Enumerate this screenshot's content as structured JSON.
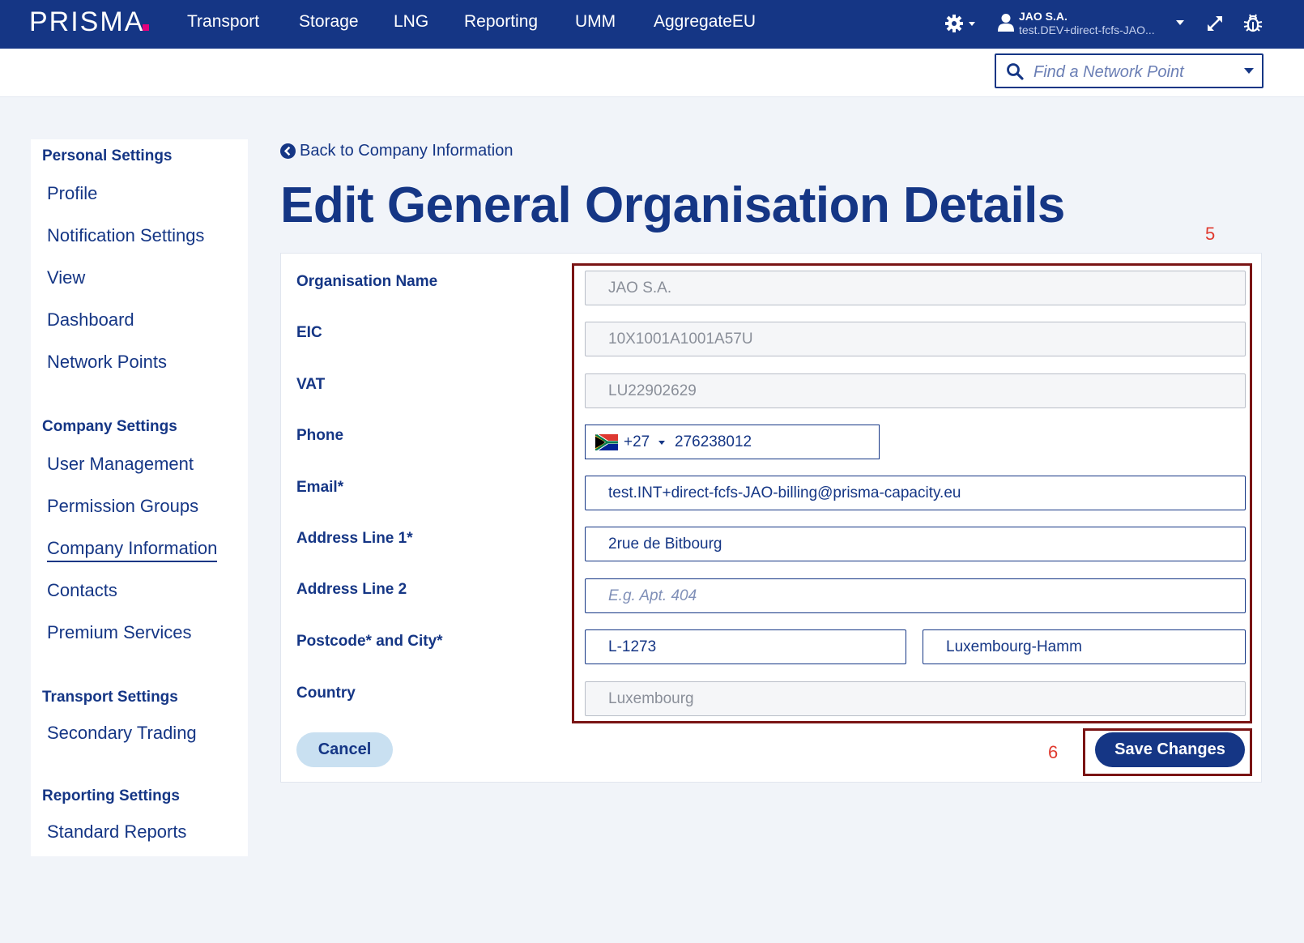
{
  "app": {
    "logo": "PRISMA"
  },
  "nav": {
    "items": [
      {
        "label": "Transport"
      },
      {
        "label": "Storage"
      },
      {
        "label": "LNG"
      },
      {
        "label": "Reporting"
      },
      {
        "label": "UMM"
      },
      {
        "label": "AggregateEU"
      }
    ]
  },
  "user": {
    "name": "JAO S.A.",
    "email": "test.DEV+direct-fcfs-JAO..."
  },
  "search": {
    "placeholder": "Find a Network Point"
  },
  "sidebar": {
    "sections": [
      {
        "title": "Personal Settings",
        "items": [
          "Profile",
          "Notification Settings",
          "View",
          "Dashboard",
          "Network Points"
        ]
      },
      {
        "title": "Company Settings",
        "items": [
          "User Management",
          "Permission Groups",
          "Company Information",
          "Contacts",
          "Premium Services"
        ]
      },
      {
        "title": "Transport Settings",
        "items": [
          "Secondary Trading"
        ]
      },
      {
        "title": "Reporting Settings",
        "items": [
          "Standard Reports"
        ]
      }
    ],
    "active_item": "Company Information"
  },
  "main": {
    "back_link": "Back to Company Information",
    "title": "Edit General Organisation Details",
    "annotations": {
      "form": "5",
      "save": "6"
    },
    "fields": {
      "org_name": {
        "label": "Organisation Name",
        "value": "JAO S.A."
      },
      "eic": {
        "label": "EIC",
        "value": "10X1001A1001A57U"
      },
      "vat": {
        "label": "VAT",
        "value": "LU22902629"
      },
      "phone": {
        "label": "Phone",
        "dial_code": "+27",
        "value": "276238012"
      },
      "email": {
        "label": "Email*",
        "value": "test.INT+direct-fcfs-JAO-billing@prisma-capacity.eu"
      },
      "address1": {
        "label": "Address Line 1*",
        "value": "2rue de Bitbourg"
      },
      "address2": {
        "label": "Address Line 2",
        "placeholder": "E.g. Apt. 404"
      },
      "postcode_city": {
        "label": "Postcode* and City*",
        "postcode": "L-1273",
        "city": "Luxembourg-Hamm"
      },
      "country": {
        "label": "Country",
        "value": "Luxembourg"
      }
    },
    "buttons": {
      "cancel": "Cancel",
      "save": "Save Changes"
    }
  }
}
